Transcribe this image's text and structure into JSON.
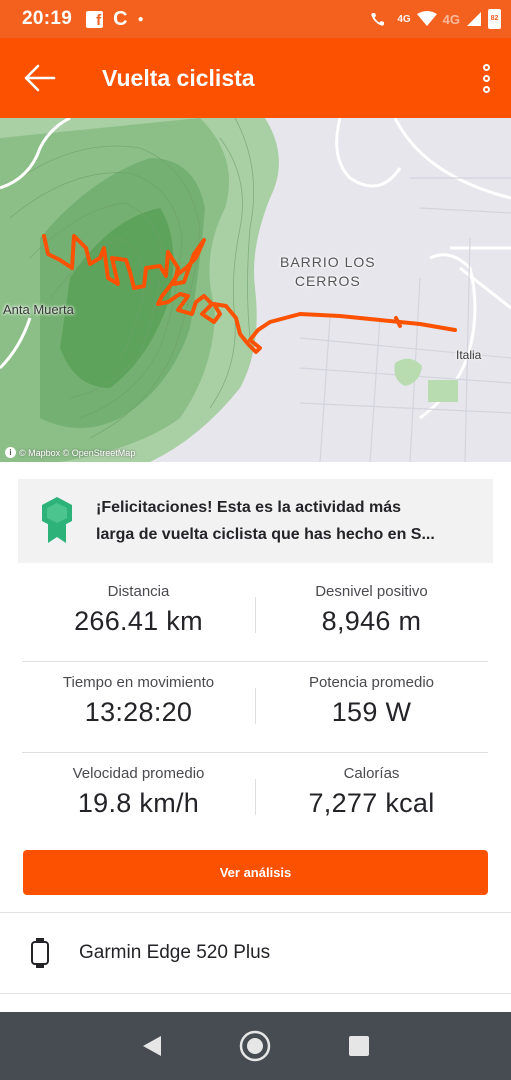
{
  "status_bar": {
    "time": "20:19",
    "network_label_1": "4G",
    "network_label_2": "4G",
    "battery": "82",
    "icons": [
      "facebook-icon",
      "sync-icon",
      "dot-icon",
      "call-4g-icon",
      "wifi-icon",
      "signal-icon",
      "battery-icon"
    ]
  },
  "app_bar": {
    "title": "Vuelta ciclista",
    "back_icon": "arrow-left-icon",
    "more_icon": "more-vertical-icon"
  },
  "map": {
    "labels": {
      "district_line1": "BARRIO LOS",
      "district_line2": "CERROS",
      "place_left": "Anta Muerta",
      "place_right": "Italia"
    },
    "attribution": "© Mapbox © OpenStreetMap",
    "route_color": "#fc5200"
  },
  "achievement": {
    "line1": "¡Felicitaciones! Esta es la actividad más",
    "line2": "larga de vuelta ciclista que has hecho en S...",
    "icon": "medal-icon",
    "icon_color": "#2db37a"
  },
  "stats": [
    {
      "label": "Distancia",
      "value": "266.41 km"
    },
    {
      "label": "Desnivel positivo",
      "value": "8,946 m"
    },
    {
      "label": "Tiempo en movimiento",
      "value": "13:28:20"
    },
    {
      "label": "Potencia promedio",
      "value": "159 W"
    },
    {
      "label": "Velocidad promedio",
      "value": "19.8 km/h"
    },
    {
      "label": "Calorías",
      "value": "7,277 kcal"
    }
  ],
  "analysis_button": {
    "label": "Ver análisis"
  },
  "device": {
    "name": "Garmin Edge 520 Plus",
    "icon": "watch-icon"
  },
  "nav_bar": {
    "icons": [
      "back-triangle-icon",
      "home-circle-icon",
      "recents-square-icon"
    ]
  },
  "colors": {
    "brand": "#fc5200",
    "status_bar": "#f4611f",
    "nav_bar": "#474c52"
  }
}
